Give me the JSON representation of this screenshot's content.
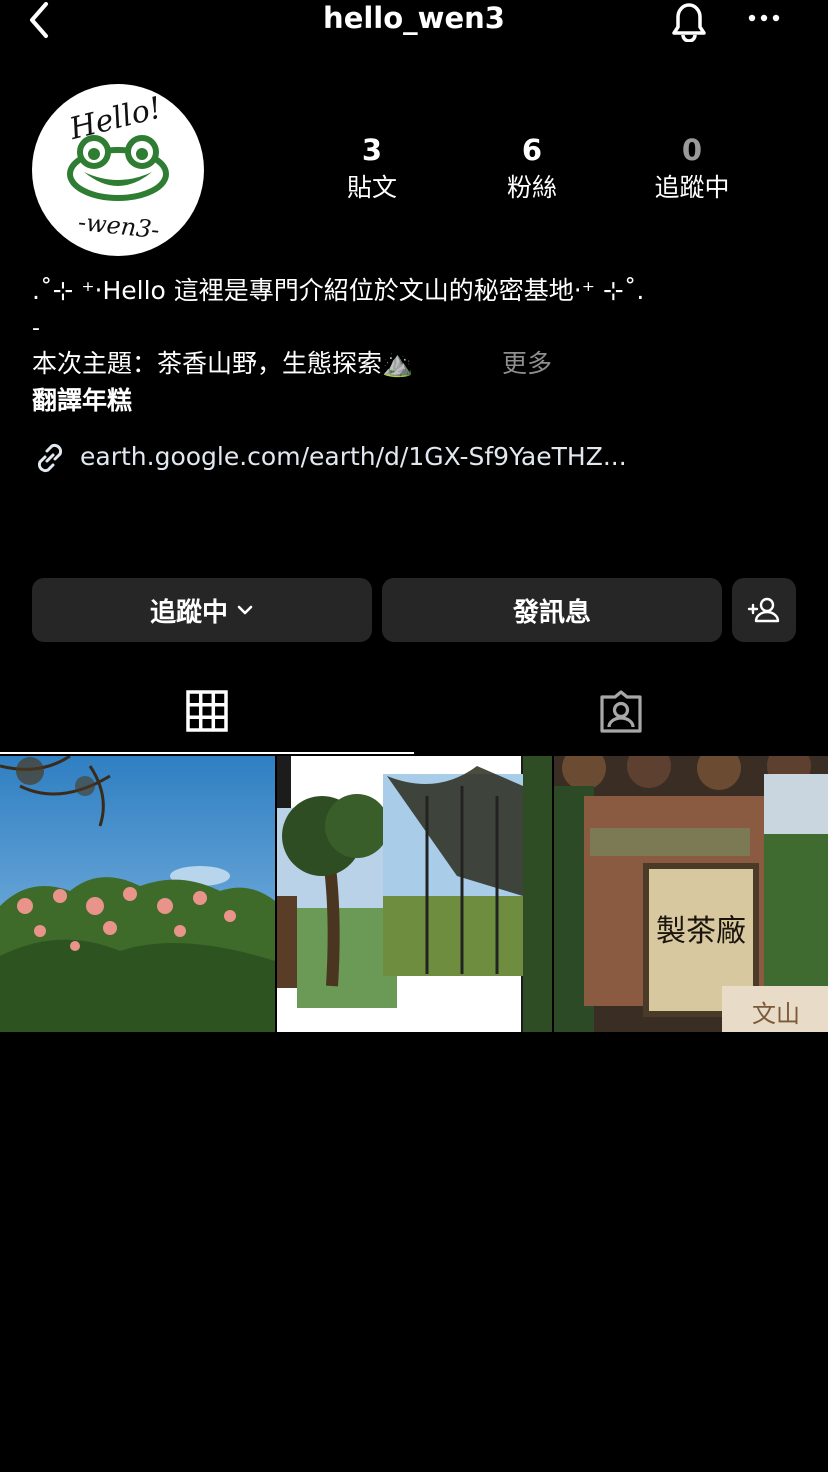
{
  "header": {
    "username": "hello_wen3"
  },
  "profile": {
    "avatar": {
      "text_top": "Hello!",
      "text_bottom": "-wen3-"
    },
    "stats": [
      {
        "value": "3",
        "label": "貼文"
      },
      {
        "value": "6",
        "label": "粉絲"
      },
      {
        "value": "0",
        "label": "追蹤中"
      }
    ]
  },
  "bio": {
    "line1": ".˚⊹ ⁺‧Hello 這裡是專門介紹位於文山的秘密基地‧⁺ ⊹˚.",
    "line2": "-",
    "line3": "本次主題：茶香山野，生態探索⛰️",
    "more": "更多",
    "translate": "翻譯年糕",
    "link": "earth.google.com/earth/d/1GX-Sf9YaeTHZ..."
  },
  "actions": {
    "following_label": "追蹤中",
    "message_label": "發訊息"
  },
  "tabs": {
    "grid": "grid-icon",
    "tagged": "tagged-person-icon"
  },
  "posts": [
    {
      "description": ""
    },
    {
      "description": ""
    },
    {
      "description": "",
      "sign_text": "製茶廠",
      "sign_text_2": "文山"
    }
  ],
  "colors": {
    "background": "#000000",
    "button": "#262626",
    "muted": "#8e8e8e",
    "following_zero": "#9a9a9a"
  }
}
